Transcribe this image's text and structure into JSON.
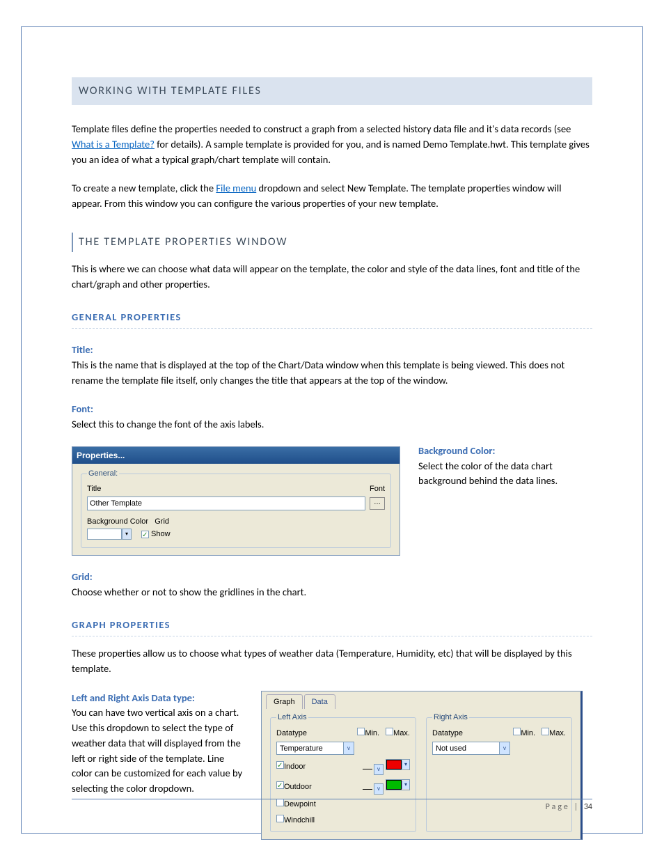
{
  "sections": {
    "working": {
      "heading": "WORKING WITH TEMPLATE FILES",
      "p1a": "Template files define the properties needed to construct a graph from a selected history data file and it's data records (see ",
      "link1": "What is a Template?",
      "p1b": " for details). A sample template is provided for you, and is named Demo Template.hwt. This template gives you an idea of what a typical graph/chart template will contain.",
      "p2a": "To create a new template, click the ",
      "link2": "File menu",
      "p2b": " dropdown and select New Template. The template properties window will appear. From this window you can configure the various properties of your new template."
    },
    "tpw": {
      "heading": "THE TEMPLATE PROPERTIES WINDOW",
      "p1": "This is where we can choose what data will appear on the template, the color and style of the data lines, font and title of the chart/graph and other properties."
    },
    "general": {
      "heading": "GENERAL PROPERTIES",
      "title_label": "Title:",
      "title_body": "This is the name that is displayed at the top of the Chart/Data window when this template is being viewed. This does not rename the template file itself, only changes the title that appears at the top of the window.",
      "font_label": "Font:",
      "font_body": "Select this to change the font of the axis labels.",
      "bg_label": "Background Color:",
      "bg_body": "Select the color of the data chart background behind the data lines.",
      "grid_label": "Grid:",
      "grid_body": "Choose whether or not to show the gridlines in the chart."
    },
    "graph": {
      "heading": "GRAPH PROPERTIES",
      "p1": "These properties allow us to choose what types of weather data (Temperature, Humidity, etc) that will be displayed by this template.",
      "axis_label_title": "Left and Right Axis Data type:",
      "axis_body": "You can have two vertical axis on a chart. Use this dropdown to select the type of weather data that will displayed from the left or right side of the template.  Line color can be customized for each value by selecting the color dropdown."
    }
  },
  "propwin": {
    "titlebar": "Properties...",
    "legend": "General:",
    "title_lbl": "Title",
    "font_lbl": "Font",
    "title_value": "Other Template",
    "bgcolor_lbl": "Background Color",
    "grid_lbl": "Grid",
    "show_lbl": "Show"
  },
  "graphbox": {
    "tab_graph": "Graph",
    "tab_data": "Data",
    "left_legend": "Left Axis",
    "right_legend": "Right Axis",
    "datatype_lbl": "Datatype",
    "min_lbl": "Min.",
    "max_lbl": "Max.",
    "left_value": "Temperature",
    "right_value": "Not used",
    "items": [
      "Indoor",
      "Outdoor",
      "Dewpoint",
      "Windchill"
    ]
  },
  "footer": {
    "label": "Page",
    "num": "34"
  }
}
